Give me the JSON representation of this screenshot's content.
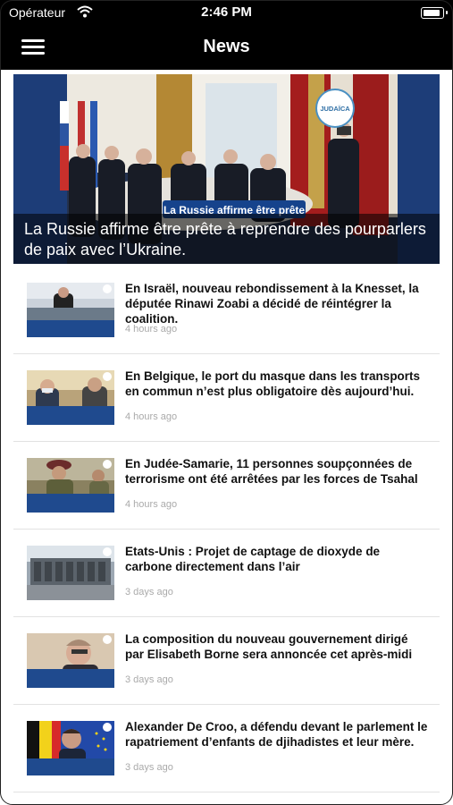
{
  "status": {
    "carrier": "Opérateur",
    "time": "2:46 PM"
  },
  "nav": {
    "title": "News"
  },
  "hero": {
    "overlay_text": "La Russie affirme être prête",
    "logo_text": "JUDAÏCA",
    "caption": "La Russie affirme être prête à reprendre des pourparlers de paix avec l’Ukraine."
  },
  "articles": [
    {
      "title": "En Israël, nouveau rebondissement à la Knesset, la députée Rinawi Zoabi a décidé de réintégrer la coalition.",
      "age": "4 hours ago"
    },
    {
      "title": "En Belgique, le port du masque dans les transports en commun n’est plus obligatoire dès aujourd’hui.",
      "age": "4 hours ago"
    },
    {
      "title": "En Judée-Samarie, 11 personnes soupçonnées de terrorisme ont été arrêtées par les forces de Tsahal",
      "age": "4 hours ago"
    },
    {
      "title": "Etats-Unis : Projet de captage de dioxyde de carbone directement dans l’air",
      "age": "3 days ago"
    },
    {
      "title": "La composition du nouveau gouvernement dirigé par Elisabeth Borne sera annoncée cet après-midi",
      "age": "3 days ago"
    },
    {
      "title": "Alexander De Croo, a défendu devant le parlement le rapatriement d’enfants de djihadistes et leur mère.",
      "age": "3 days ago"
    }
  ]
}
